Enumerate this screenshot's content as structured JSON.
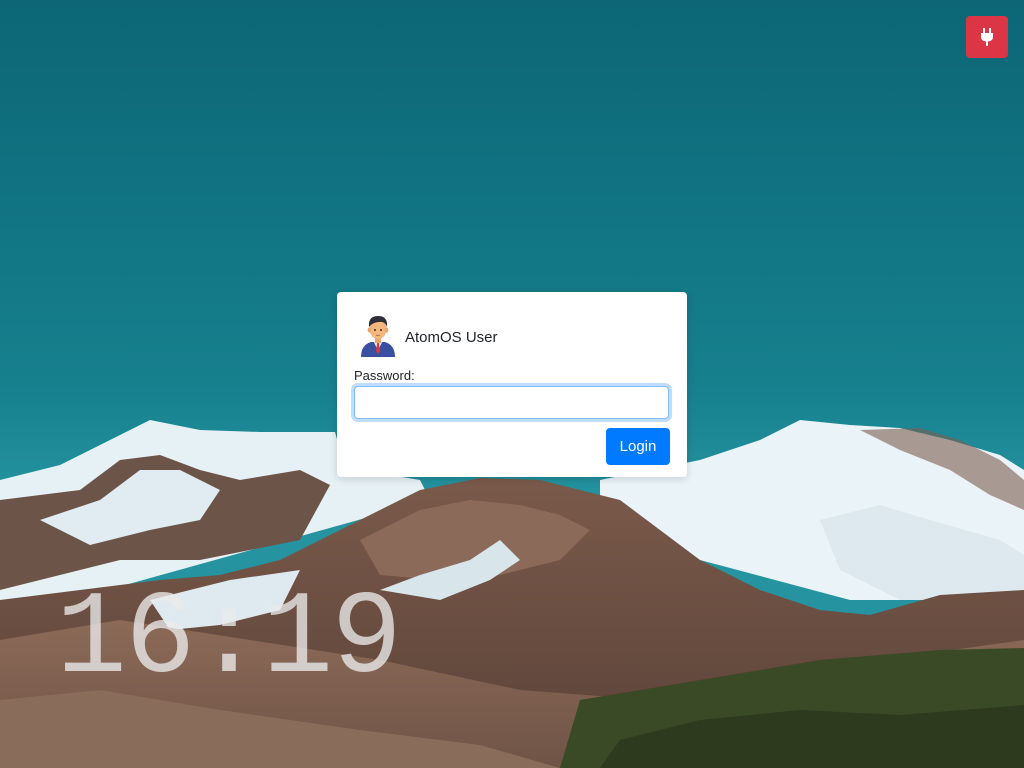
{
  "wallpaper": {
    "sky_color": "#13788a",
    "snow_color": "#e8f3f7",
    "rock_color": "#6e5448",
    "forest_color": "#2d3a1e"
  },
  "power_button": {
    "icon": "plug-icon",
    "color": "#dc3545"
  },
  "login": {
    "avatar_icon": "user-avatar-icon",
    "username": "AtomOS User",
    "password_label": "Password:",
    "password_value": "",
    "login_label": "Login",
    "button_color": "#007bff"
  },
  "clock": {
    "time": "16:19"
  }
}
